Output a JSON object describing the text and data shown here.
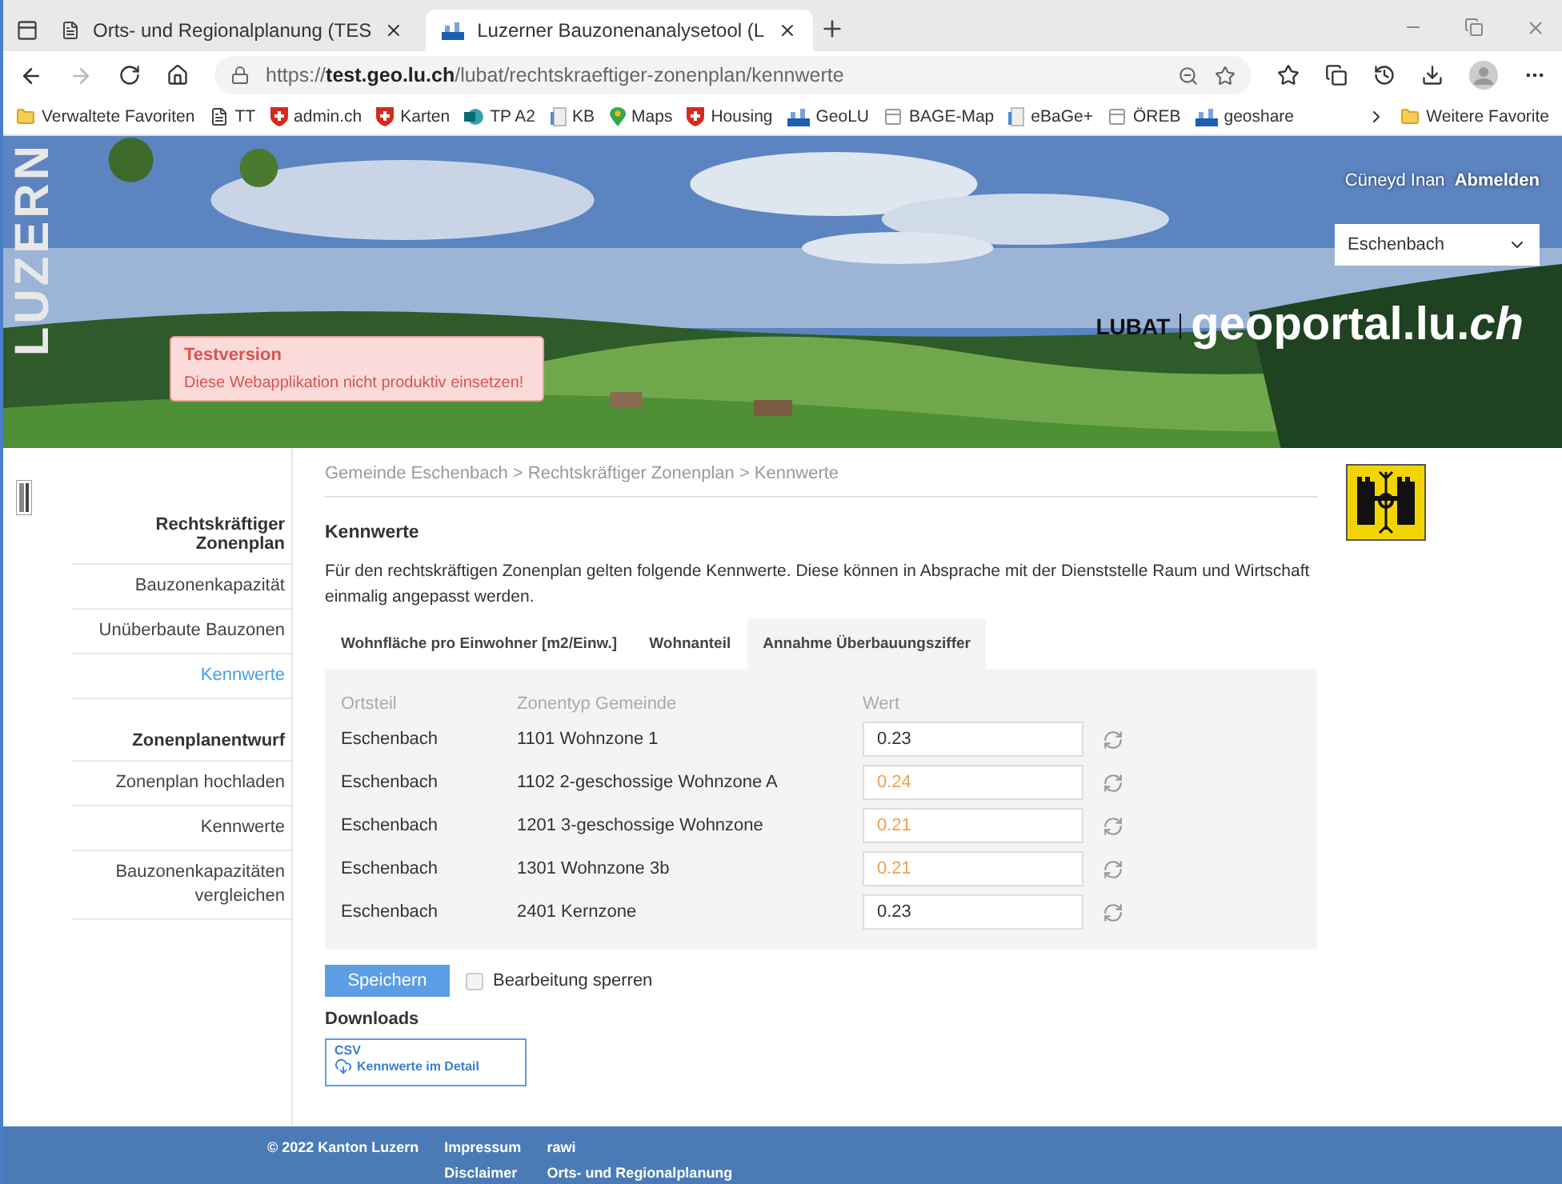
{
  "browser": {
    "tabs": [
      {
        "title": "Orts- und Regionalplanung (TES",
        "selected": false,
        "kind": "page"
      },
      {
        "title": "Luzerner Bauzonenanalysetool (L",
        "selected": true,
        "kind": "geo"
      }
    ],
    "url": "https://**test.geo.lu.ch**/lubat/rechtskraeftiger-zonenplan/kennwerte",
    "favorites": [
      {
        "label": "Verwaltete Favoriten",
        "kind": "folder"
      },
      {
        "label": "TT",
        "kind": "page"
      },
      {
        "label": "admin.ch",
        "kind": "swiss"
      },
      {
        "label": "Karten",
        "kind": "swiss"
      },
      {
        "label": "TP A2",
        "kind": "share"
      },
      {
        "label": "KB",
        "kind": "doc"
      },
      {
        "label": "Maps",
        "kind": "pin"
      },
      {
        "label": "Housing",
        "kind": "swiss"
      },
      {
        "label": "GeoLU",
        "kind": "geo"
      },
      {
        "label": "BAGE-Map",
        "kind": "blank"
      },
      {
        "label": "eBaGe+",
        "kind": "doc"
      },
      {
        "label": "ÖREB",
        "kind": "blank"
      },
      {
        "label": "geoshare",
        "kind": "geo"
      }
    ],
    "more_favorites": "Weitere Favorite"
  },
  "header": {
    "user": "Cüneyd Inan",
    "logout": "Abmelden",
    "commune": "Eschenbach",
    "brand": "LUBAT",
    "portal": "geoportal.lu.*ch*",
    "side_logo": "LUZERN",
    "notice": {
      "title": "Testversion",
      "text": "Diese Webapplikation nicht produktiv einsetzen!"
    }
  },
  "sidebar": [
    {
      "title": "Rechtskräftiger Zonenplan",
      "items": [
        {
          "label": "Bauzonenkapazität",
          "selected": false
        },
        {
          "label": "Unüberbaute Bauzonen",
          "selected": false
        },
        {
          "label": "Kennwerte",
          "selected": true
        }
      ]
    },
    {
      "title": "Zonenplanentwurf",
      "items": [
        {
          "label": "Zonenplan hochladen",
          "selected": false
        },
        {
          "label": "Kennwerte",
          "selected": false
        },
        {
          "label": "Bauzonenkapazitäten vergleichen",
          "selected": false
        }
      ]
    }
  ],
  "main": {
    "breadcrumb": "Gemeinde Eschenbach > Rechtskräftiger Zonenplan > Kennwerte",
    "heading": "Kennwerte",
    "description": "Für den rechtskräftigen Zonenplan gelten folgende Kennwerte. Diese können in Absprache mit der Dienststelle Raum und Wirtschaft einmalig angepasst werden.",
    "tabs": [
      {
        "label": "Wohnfläche pro Einwohner [m2/Einw.]",
        "selected": false
      },
      {
        "label": "Wohnanteil",
        "selected": false
      },
      {
        "label": "Annahme Überbauungsziffer",
        "selected": true
      }
    ],
    "table": {
      "columns": [
        "Ortsteil",
        "Zonentyp Gemeinde",
        "Wert"
      ],
      "rows": [
        {
          "ortsteil": "Eschenbach",
          "zonentyp": "1101 Wohnzone 1",
          "wert": "0.23",
          "changed": false
        },
        {
          "ortsteil": "Eschenbach",
          "zonentyp": "1102 2-geschossige Wohnzone A",
          "wert": "0.24",
          "changed": true
        },
        {
          "ortsteil": "Eschenbach",
          "zonentyp": "1201 3-geschossige Wohnzone",
          "wert": "0.21",
          "changed": true
        },
        {
          "ortsteil": "Eschenbach",
          "zonentyp": "1301 Wohnzone 3b",
          "wert": "0.21",
          "changed": true
        },
        {
          "ortsteil": "Eschenbach",
          "zonentyp": "2401 Kernzone",
          "wert": "0.23",
          "changed": false
        }
      ]
    },
    "save": "Speichern",
    "lock": {
      "label": "Bearbeitung sperren",
      "checked": false
    },
    "downloads": "Downloads",
    "download": {
      "format": "CSV",
      "label": "Kennwerte im Detail"
    }
  },
  "footer": {
    "copyright": "© 2022 Kanton Luzern",
    "links": [
      [
        "Impressum",
        "Disclaimer"
      ],
      [
        "rawi",
        "Orts- und Regionalplanung"
      ]
    ]
  }
}
